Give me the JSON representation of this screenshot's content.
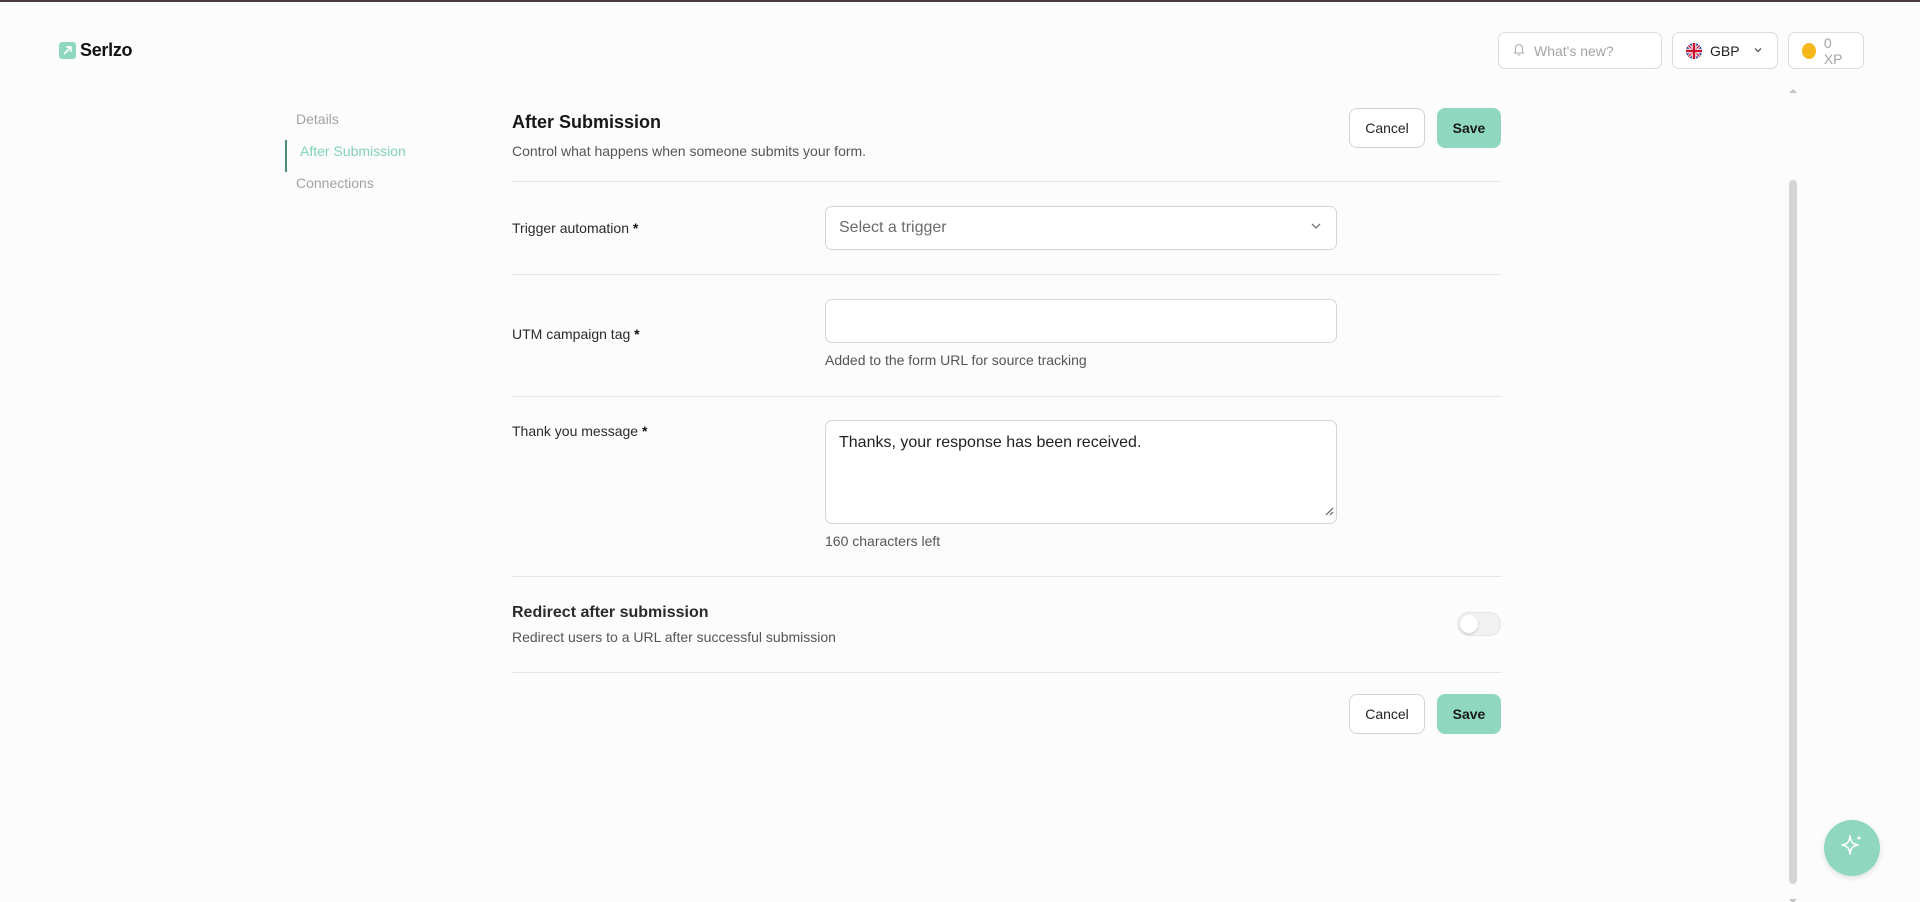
{
  "app": {
    "name": "Serlzo"
  },
  "header": {
    "whats_new": "What's new?",
    "currency": "GBP",
    "xp": "0 XP"
  },
  "sidebar": {
    "items": [
      {
        "label": "Details",
        "active": false
      },
      {
        "label": "After Submission",
        "active": true
      },
      {
        "label": "Connections",
        "active": false
      }
    ]
  },
  "section": {
    "title": "After Submission",
    "subtitle": "Control what happens when someone submits your form."
  },
  "actions": {
    "cancel": "Cancel",
    "save": "Save"
  },
  "fields": {
    "trigger": {
      "label": "Trigger automation",
      "required": "*",
      "placeholder": "Select a trigger"
    },
    "utm": {
      "label": "UTM campaign tag",
      "required": "*",
      "value": "",
      "hint": "Added to the form URL for source tracking"
    },
    "thank_you": {
      "label": "Thank you message",
      "required": "*",
      "value": "Thanks, your response has been received.",
      "counter": "160 characters left"
    }
  },
  "redirect": {
    "title": "Redirect after submission",
    "subtitle": "Redirect users to a URL after successful submission",
    "enabled": false
  },
  "colors": {
    "accent": "#8fd8bf",
    "active_nav": "#82d3b8",
    "nav_marker": "#4a8c76"
  }
}
